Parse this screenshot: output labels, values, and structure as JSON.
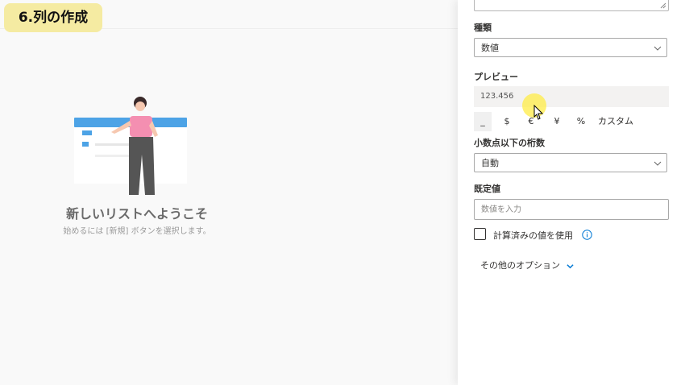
{
  "step_badge": "6.列の作成",
  "welcome": {
    "title": "新しいリストへようこそ",
    "subtitle": "始めるには [新規] ボタンを選択します。"
  },
  "panel": {
    "type_label": "種類",
    "type_value": "数値",
    "preview_label": "プレビュー",
    "preview_value": "123.456",
    "format_options": [
      "_",
      "$",
      "€",
      "¥",
      "%",
      "カスタム"
    ],
    "selected_format": "_",
    "decimal_label": "小数点以下の桁数",
    "decimal_value": "自動",
    "default_label": "既定値",
    "default_placeholder": "数値を入力",
    "calc_checkbox_label": "計算済みの値を使用",
    "more_options": "その他のオプション"
  },
  "colors": {
    "badge": "#f5eba2",
    "accent": "#0078d4",
    "illustration_shirt": "#f48fb1",
    "cursor_highlight": "#ffec46"
  }
}
